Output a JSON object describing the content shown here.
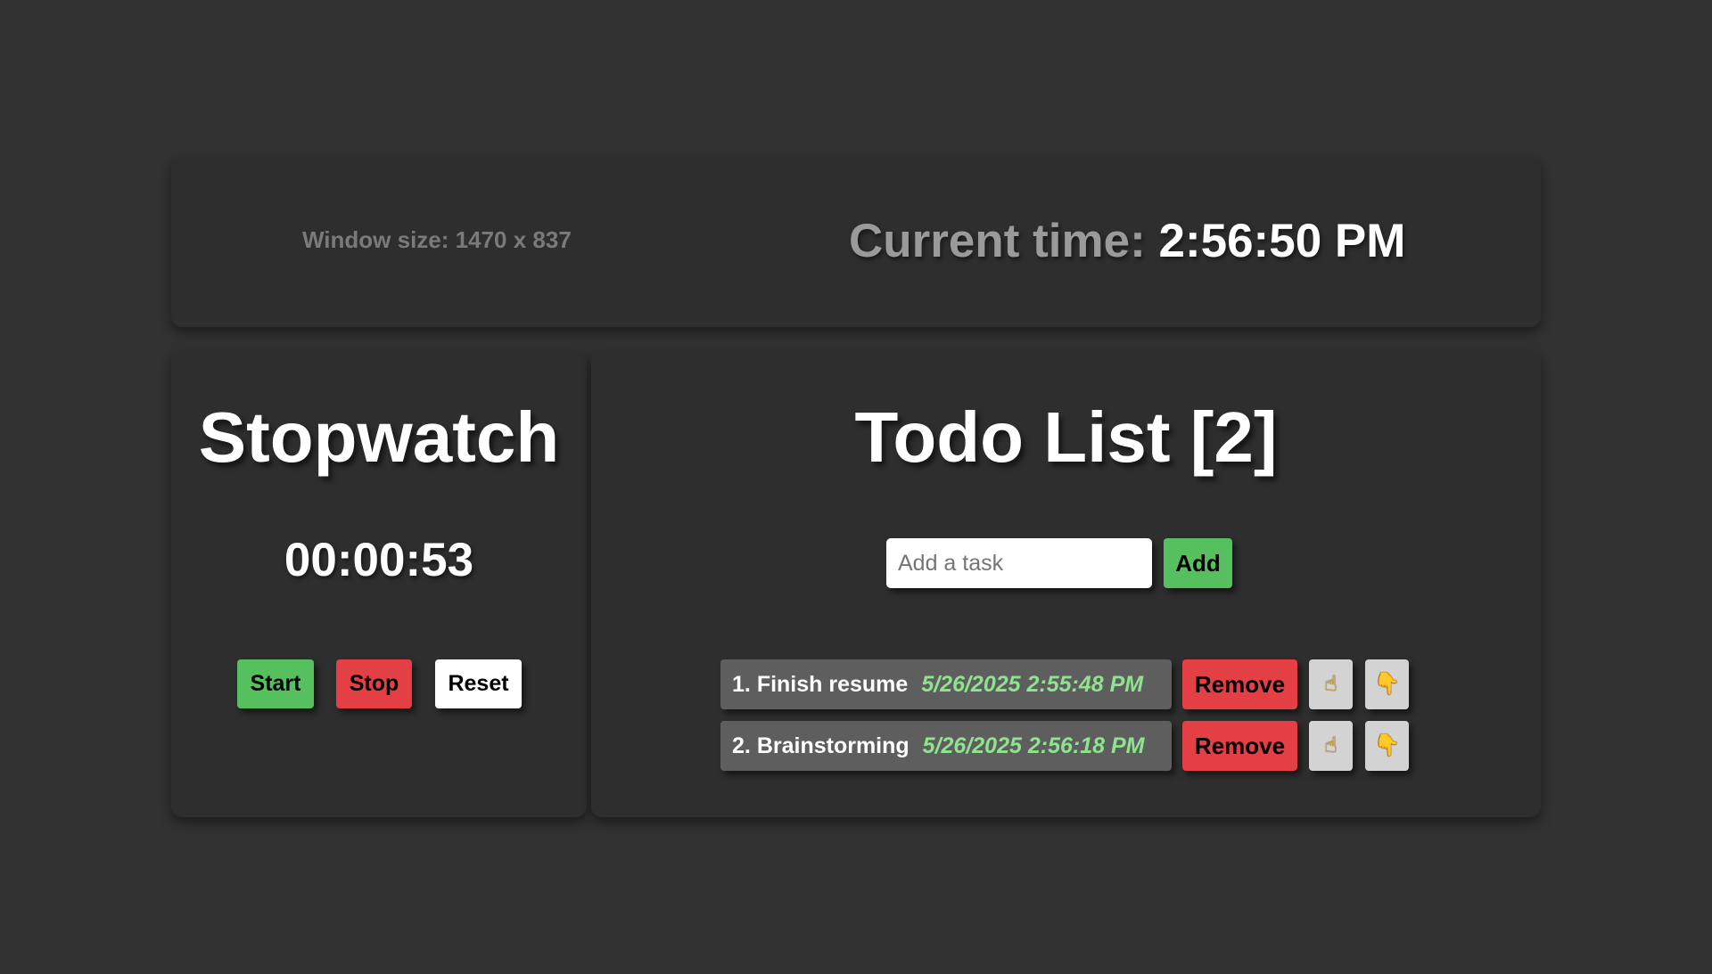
{
  "header": {
    "window_size_text": "Window size: 1470 x 837",
    "current_time_label": "Current time: ",
    "current_time_value": "2:56:50 PM"
  },
  "stopwatch": {
    "title": "Stopwatch",
    "time": "00:00:53",
    "start_label": "Start",
    "stop_label": "Stop",
    "reset_label": "Reset"
  },
  "todo": {
    "title": "Todo List [2]",
    "input_placeholder": "Add a task",
    "input_value": "",
    "add_label": "Add",
    "items": [
      {
        "index": "1.",
        "label": "Finish resume",
        "date": "5/26/2025 2:55:48 PM",
        "remove_label": "Remove",
        "up_icon": "☝",
        "down_icon": "👇"
      },
      {
        "index": "2.",
        "label": "Brainstorming",
        "date": "5/26/2025 2:56:18 PM",
        "remove_label": "Remove",
        "up_icon": "☝",
        "down_icon": "👇"
      }
    ]
  },
  "colors": {
    "background": "#323232",
    "panel": "#2e2e2e",
    "green": "#56c05e",
    "red": "#e33f45",
    "date_green": "#8fe38f",
    "item_gray": "#5e5e5e",
    "move_button_gray": "#d3d3d3"
  },
  "icons": {
    "up": "pointing-up-hand-icon",
    "down": "pointing-down-hand-icon"
  }
}
